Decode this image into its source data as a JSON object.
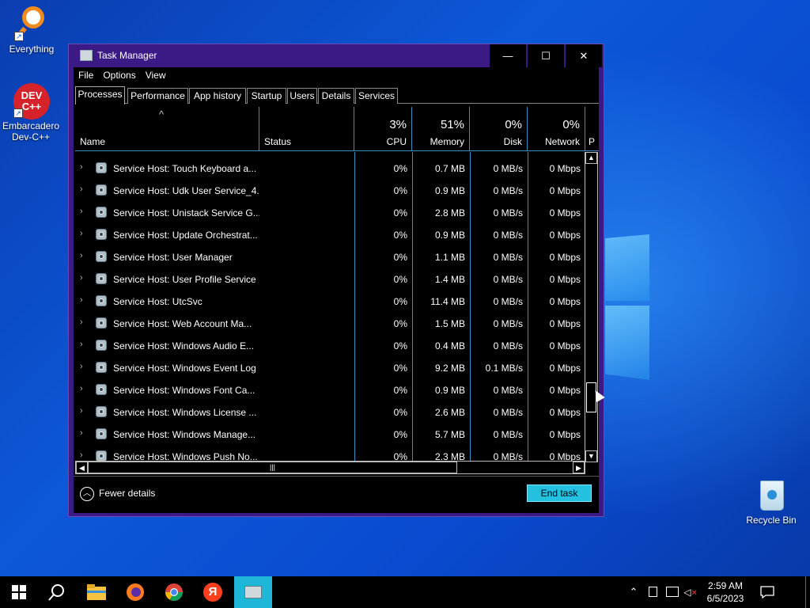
{
  "desktop": {
    "icons": [
      {
        "label": "Everything",
        "icon": "everything-icon"
      },
      {
        "label": "Embarcadero Dev-C++",
        "icon": "devcpp-icon",
        "badge": "DEV C++"
      },
      {
        "label": "Recycle Bin",
        "icon": "recycle-bin-icon"
      }
    ]
  },
  "window": {
    "title": "Task Manager",
    "minimize": "—",
    "maximize": "☐",
    "close": "✕"
  },
  "menu": [
    "File",
    "Options",
    "View"
  ],
  "tabs": [
    "Processes",
    "Performance",
    "App history",
    "Startup",
    "Users",
    "Details",
    "Services"
  ],
  "active_tab": "Processes",
  "columns": {
    "sort_indicator": "^",
    "name": "Name",
    "status": "Status",
    "cpu": {
      "pct": "3%",
      "label": "CPU"
    },
    "memory": {
      "pct": "51%",
      "label": "Memory"
    },
    "disk": {
      "pct": "0%",
      "label": "Disk"
    },
    "network": {
      "pct": "0%",
      "label": "Network"
    },
    "power": "P"
  },
  "rows": [
    {
      "name": "Service Host: Touch Keyboard a...",
      "cpu": "0%",
      "memory": "0.7 MB",
      "disk": "0 MB/s",
      "network": "0 Mbps"
    },
    {
      "name": "Service Host: Udk User Service_4...",
      "cpu": "0%",
      "memory": "0.9 MB",
      "disk": "0 MB/s",
      "network": "0 Mbps"
    },
    {
      "name": "Service Host: Unistack Service G...",
      "cpu": "0%",
      "memory": "2.8 MB",
      "disk": "0 MB/s",
      "network": "0 Mbps"
    },
    {
      "name": "Service Host: Update Orchestrat...",
      "cpu": "0%",
      "memory": "0.9 MB",
      "disk": "0 MB/s",
      "network": "0 Mbps"
    },
    {
      "name": "Service Host: User Manager",
      "cpu": "0%",
      "memory": "1.1 MB",
      "disk": "0 MB/s",
      "network": "0 Mbps"
    },
    {
      "name": "Service Host: User Profile Service",
      "cpu": "0%",
      "memory": "1.4 MB",
      "disk": "0 MB/s",
      "network": "0 Mbps"
    },
    {
      "name": "Service Host: UtcSvc",
      "cpu": "0%",
      "memory": "11.4 MB",
      "disk": "0 MB/s",
      "network": "0 Mbps"
    },
    {
      "name": "Service Host: Web Account Ma...",
      "cpu": "0%",
      "memory": "1.5 MB",
      "disk": "0 MB/s",
      "network": "0 Mbps"
    },
    {
      "name": "Service Host: Windows Audio E...",
      "cpu": "0%",
      "memory": "0.4 MB",
      "disk": "0 MB/s",
      "network": "0 Mbps"
    },
    {
      "name": "Service Host: Windows Event Log",
      "cpu": "0%",
      "memory": "9.2 MB",
      "disk": "0.1 MB/s",
      "network": "0 Mbps"
    },
    {
      "name": "Service Host: Windows Font Ca...",
      "cpu": "0%",
      "memory": "0.9 MB",
      "disk": "0 MB/s",
      "network": "0 Mbps"
    },
    {
      "name": "Service Host: Windows License ...",
      "cpu": "0%",
      "memory": "2.6 MB",
      "disk": "0 MB/s",
      "network": "0 Mbps"
    },
    {
      "name": "Service Host: Windows Manage...",
      "cpu": "0%",
      "memory": "5.7 MB",
      "disk": "0 MB/s",
      "network": "0 Mbps"
    },
    {
      "name": "Service Host: Windows Push No...",
      "cpu": "0%",
      "memory": "2.3 MB",
      "disk": "0 MB/s",
      "network": "0 Mbps"
    }
  ],
  "footer": {
    "fewer_details": "Fewer details",
    "end_task": "End task"
  },
  "taskbar": {
    "apps": [
      "start-icon",
      "search-icon",
      "file-explorer-icon",
      "firefox-icon",
      "chrome-icon",
      "yandex-icon",
      "task-manager-icon"
    ],
    "yandex_glyph": "Я",
    "clock_time": "2:59 AM",
    "clock_date": "6/5/2023"
  },
  "colors": {
    "accent": "#23c0e0",
    "titlebar": "#3c1a86",
    "grid_lines": "#3a8fc0"
  }
}
